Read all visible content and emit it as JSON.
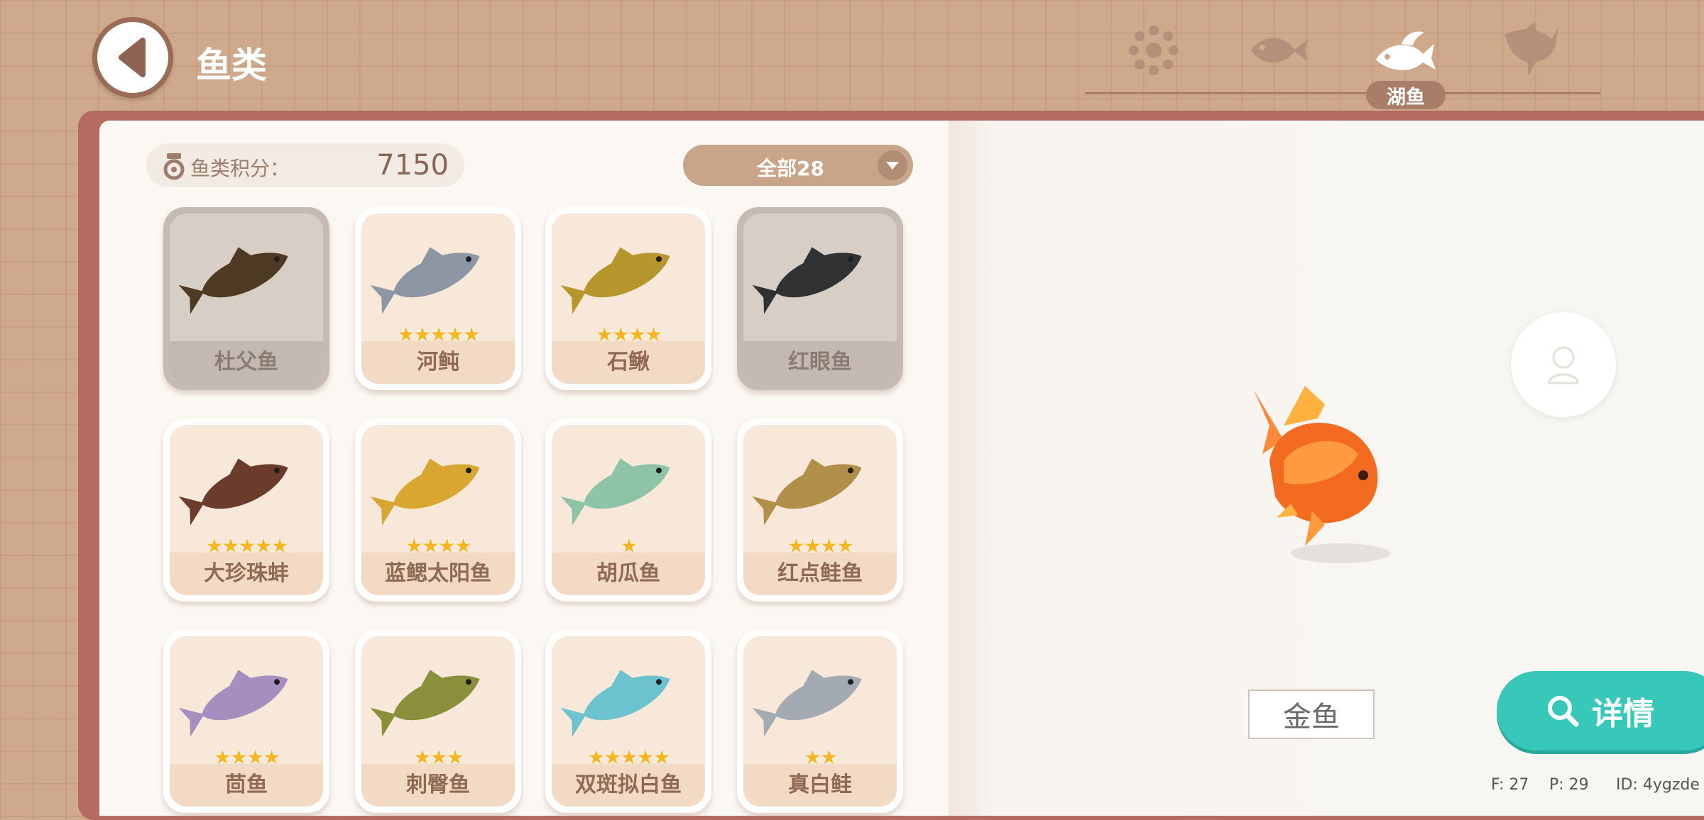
{
  "header": {
    "title": "鱼类",
    "category_tabs": [
      {
        "icon": "all-flower-icon",
        "active": false
      },
      {
        "icon": "fish-icon",
        "active": false
      },
      {
        "icon": "lake-fish-icon",
        "active": true,
        "label": "湖鱼"
      },
      {
        "icon": "shark-icon",
        "active": false
      }
    ]
  },
  "sidebar": {
    "score_label": "鱼类积分：",
    "score_value": "7150",
    "filter_label": "全部28"
  },
  "fish_list": [
    {
      "name": "杜父鱼",
      "stars": 0,
      "locked": true,
      "color": "#4e3a22"
    },
    {
      "name": "河鲀",
      "stars": 5,
      "locked": false,
      "color": "#8c97a3"
    },
    {
      "name": "石鳅",
      "stars": 4,
      "locked": false,
      "color": "#b7962e"
    },
    {
      "name": "红眼鱼",
      "stars": 0,
      "locked": true,
      "color": "#2f3133"
    },
    {
      "name": "大珍珠蚌",
      "stars": 5,
      "locked": false,
      "color": "#6b3b2c"
    },
    {
      "name": "蓝鳃太阳鱼",
      "stars": 4,
      "locked": false,
      "color": "#d9a631"
    },
    {
      "name": "胡瓜鱼",
      "stars": 1,
      "locked": false,
      "color": "#8fc3a7"
    },
    {
      "name": "红点鲑鱼",
      "stars": 4,
      "locked": false,
      "color": "#b08f48"
    },
    {
      "name": "茴鱼",
      "stars": 4,
      "locked": false,
      "color": "#a58fbf"
    },
    {
      "name": "刺臀鱼",
      "stars": 3,
      "locked": false,
      "color": "#8a8f3c"
    },
    {
      "name": "双斑拟白鱼",
      "stars": 5,
      "locked": false,
      "color": "#6cc2cf"
    },
    {
      "name": "真白鲑",
      "stars": 2,
      "locked": false,
      "color": "#a3aab2"
    }
  ],
  "detail": {
    "fish_name": "金鱼",
    "detail_button": "详情"
  },
  "debug": {
    "f_text": "F: 27",
    "p_text": "P: 29",
    "id_text": "ID: 4ygzde"
  },
  "colors": {
    "accent": "#38c8b9",
    "star": "#f6b624",
    "book_frame": "#b46c62"
  }
}
